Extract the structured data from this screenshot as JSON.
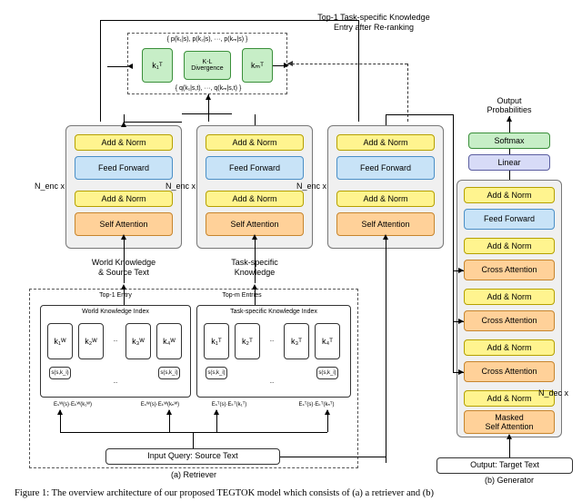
{
  "rerank": {
    "title_line1": "Top-1 Task-specific Knowledge",
    "title_line2": "Entry after Re-ranking",
    "p_dist": "{ p(k₁|s), p(k₂|s), ···, p(kₘ|s) }",
    "q_dist": "{ q(k₁|s,t), ···, q(kₘ|s,t) }",
    "k1": "k₁ᵀ",
    "km": "kₘᵀ",
    "kl": "K-L\nDivergence"
  },
  "output": {
    "label": "Output\nProbabilities",
    "softmax": "Softmax",
    "linear": "Linear"
  },
  "encoder": {
    "n_label": "N_enc x",
    "add_norm": "Add & Norm",
    "feed_forward": "Feed Forward",
    "self_attention": "Self Attention",
    "src1_line1": "World Knowledge",
    "src1_line2": "& Source Text",
    "src2_line1": "Task-specific",
    "src2_line2": "Knowledge"
  },
  "decoder": {
    "n_label": "N_dec x",
    "add_norm": "Add & Norm",
    "feed_forward": "Feed Forward",
    "cross_attention": "Cross Attention",
    "masked_self": "Masked\nSelf Attention",
    "io_label": "Output: Target Text",
    "panel_label": "(b) Generator"
  },
  "retriever": {
    "top1": "Top-1 Entry",
    "topm": "Top-m Entries",
    "world_idx": "World Knowledge Index",
    "task_idx": "Task-specific Knowledge Index",
    "kw1": "k₁ᵂ",
    "kw2": "k₂ᵂ",
    "kw3": "k₃ᵂ",
    "kw4": "k₄ᵂ",
    "kt1": "k₁ᵀ",
    "kt2": "k₂ᵀ",
    "kt3": "k₃ᵀ",
    "kt4": "k₄ᵀ",
    "sim": "s(s,k_i)",
    "score_w1": "Eₛᵂ(s)·Eₖᵂ(k₁ᵂ)",
    "score_w2": "Eₛᵂ(s)·Eₖᵂ(kₙᵂ)",
    "score_t1": "Eₛᵀ(s)·Eₖᵀ(k₁ᵀ)",
    "score_t2": "Eₛᵀ(s)·Eₖᵀ(kₙᵀ)",
    "dots": "...",
    "io_label": "Input Query: Source Text",
    "panel_label": "(a) Retriever"
  },
  "caption": "Figure 1: The overview architecture of our proposed TEGTOK model which consists of (a) a retriever and (b)"
}
